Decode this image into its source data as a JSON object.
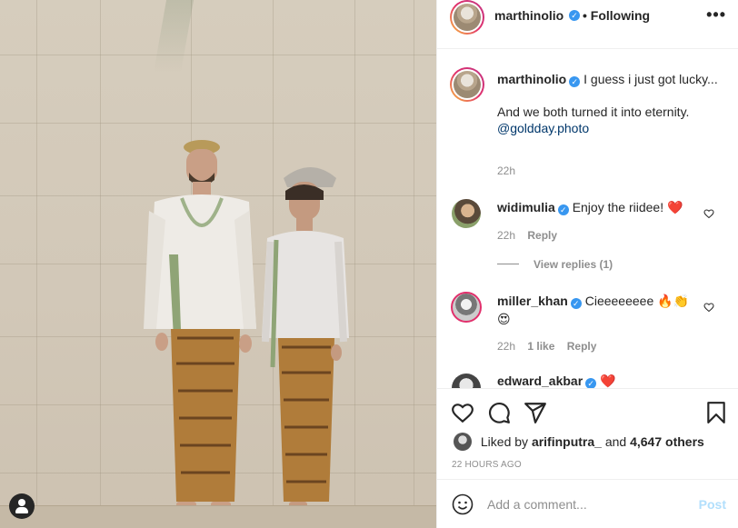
{
  "header": {
    "username": "marthinolio",
    "follow_status": "• Following",
    "more_icon": "more-horizontal-icon"
  },
  "caption": {
    "username": "marthinolio",
    "line1": "I guess i just got lucky...",
    "line2": "And we both turned it into eternity.",
    "mention": "@goldday.photo",
    "time": "22h"
  },
  "comments": [
    {
      "username": "widimulia",
      "text": "Enjoy the riidee!",
      "emoji": "❤️",
      "time": "22h",
      "reply": "Reply",
      "view_replies": "View replies (1)"
    },
    {
      "username": "miller_khan",
      "text": "Cieeeeeeee",
      "emoji": "🔥👏",
      "emoji2": "😍",
      "time": "22h",
      "likes": "1 like",
      "reply": "Reply"
    },
    {
      "username": "edward_akbar",
      "emoji": "❤️"
    }
  ],
  "likes": {
    "prefix": "Liked by",
    "user": "arifinputra_",
    "and": "and",
    "count": "4,647 others"
  },
  "posted_time": "22 HOURS AGO",
  "add_comment": {
    "placeholder": "Add a comment...",
    "post_label": "Post"
  },
  "colors": {
    "verified": "#3897f0",
    "link": "#00376b",
    "muted": "#8e8e8e",
    "post_disabled": "#b2dffc"
  }
}
